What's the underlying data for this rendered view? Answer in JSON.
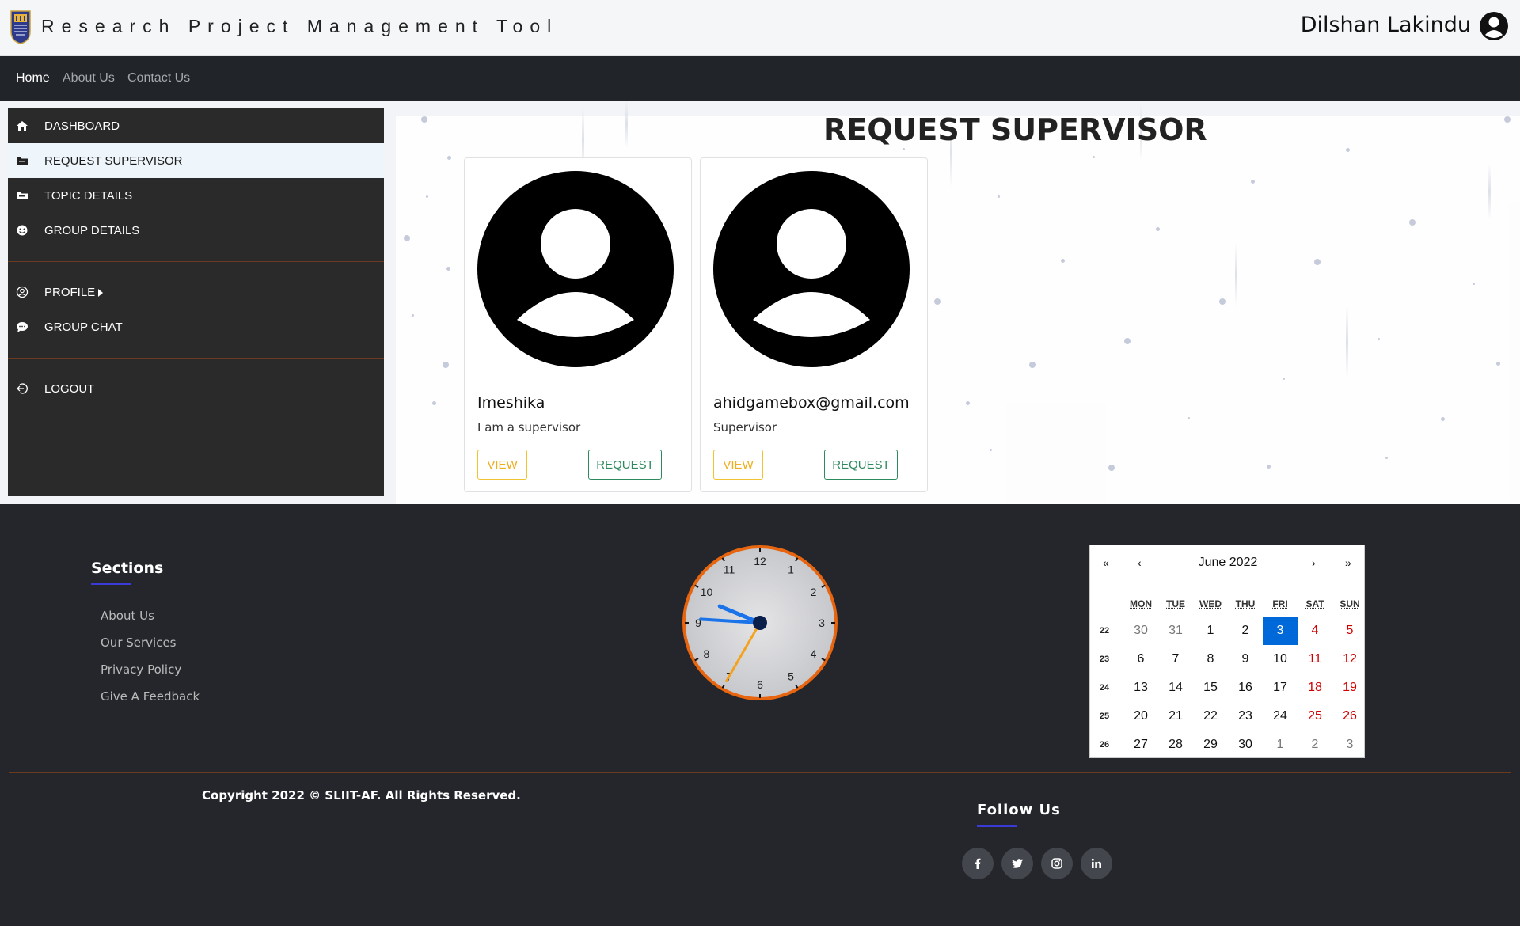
{
  "header": {
    "app_title": "Research Project Management Tool",
    "user_name": "Dilshan Lakindu"
  },
  "nav": {
    "links": [
      {
        "label": "Home",
        "active": true
      },
      {
        "label": "About Us"
      },
      {
        "label": "Contact Us"
      }
    ]
  },
  "sidebar": {
    "items": [
      {
        "label": "DASHBOARD",
        "icon": "home-icon"
      },
      {
        "label": "REQUEST SUPERVISOR",
        "icon": "folder-icon",
        "active": true
      },
      {
        "label": "TOPIC DETAILS",
        "icon": "folder-icon"
      },
      {
        "label": "GROUP DETAILS",
        "icon": "smile-icon"
      },
      {
        "label": "PROFILE",
        "icon": "user-circle-icon",
        "has_submenu": true
      },
      {
        "label": "GROUP CHAT",
        "icon": "chat-icon"
      },
      {
        "label": "LOGOUT",
        "icon": "logout-icon"
      }
    ]
  },
  "main": {
    "title": "REQUEST SUPERVISOR",
    "supervisors": [
      {
        "name": "Imeshika",
        "description": "I am a supervisor",
        "view_label": "VIEW",
        "request_label": "REQUEST"
      },
      {
        "name": "ahidgamebox@gmail.com",
        "description": "Supervisor",
        "view_label": "VIEW",
        "request_label": "REQUEST"
      }
    ]
  },
  "footer": {
    "sections_title": "Sections",
    "section_links": [
      "About Us",
      "Our Services",
      "Privacy Policy",
      "Give A Feedback"
    ],
    "copyright": "Copyright 2022 © SLIIT-AF. All Rights Reserved.",
    "follow_title": "Follow Us",
    "social": [
      "facebook-icon",
      "twitter-icon",
      "instagram-icon",
      "linkedin-icon"
    ]
  },
  "clock": {
    "numbers": [
      "12",
      "1",
      "2",
      "3",
      "4",
      "5",
      "6",
      "7",
      "8",
      "9",
      "10",
      "11"
    ],
    "time": {
      "hour": 9,
      "minute": 45,
      "second": 35
    },
    "ring_color": "#e8650f",
    "hand_color": "#1a73e8",
    "second_color": "#f4a21c"
  },
  "calendar": {
    "month_label": "June 2022",
    "nav": {
      "prev_year": "«",
      "prev_month": "‹",
      "next_month": "›",
      "next_year": "»"
    },
    "weekdays": [
      "MON",
      "TUE",
      "WED",
      "THU",
      "FRI",
      "SAT",
      "SUN"
    ],
    "weeks": [
      {
        "num": "22",
        "days": [
          {
            "d": "30",
            "o": true
          },
          {
            "d": "31",
            "o": true
          },
          {
            "d": "1"
          },
          {
            "d": "2"
          },
          {
            "d": "3",
            "today": true
          },
          {
            "d": "4",
            "w": true
          },
          {
            "d": "5",
            "w": true
          }
        ]
      },
      {
        "num": "23",
        "days": [
          {
            "d": "6"
          },
          {
            "d": "7"
          },
          {
            "d": "8"
          },
          {
            "d": "9"
          },
          {
            "d": "10"
          },
          {
            "d": "11",
            "w": true
          },
          {
            "d": "12",
            "w": true
          }
        ]
      },
      {
        "num": "24",
        "days": [
          {
            "d": "13"
          },
          {
            "d": "14"
          },
          {
            "d": "15"
          },
          {
            "d": "16"
          },
          {
            "d": "17"
          },
          {
            "d": "18",
            "w": true
          },
          {
            "d": "19",
            "w": true
          }
        ]
      },
      {
        "num": "25",
        "days": [
          {
            "d": "20"
          },
          {
            "d": "21"
          },
          {
            "d": "22"
          },
          {
            "d": "23"
          },
          {
            "d": "24"
          },
          {
            "d": "25",
            "w": true
          },
          {
            "d": "26",
            "w": true
          }
        ]
      },
      {
        "num": "26",
        "days": [
          {
            "d": "27"
          },
          {
            "d": "28"
          },
          {
            "d": "29"
          },
          {
            "d": "30"
          },
          {
            "d": "1",
            "o": true
          },
          {
            "d": "2",
            "o": true
          },
          {
            "d": "3",
            "o": true
          }
        ]
      }
    ]
  }
}
